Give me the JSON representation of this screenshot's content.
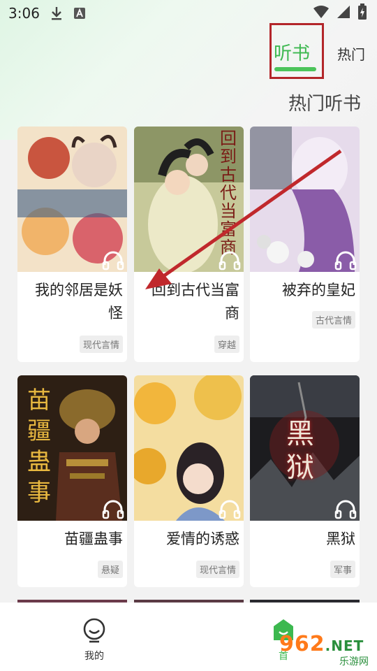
{
  "status_bar": {
    "time": "3:06",
    "icons": [
      "download-icon",
      "text-a-icon",
      "wifi-icon",
      "signal-icon",
      "battery-charging-icon"
    ]
  },
  "tabs": {
    "active": "听书",
    "other": "热门"
  },
  "section_title": "热门听书",
  "books": [
    {
      "title": "我的邻居是妖怪",
      "tag": "现代言情"
    },
    {
      "title": "回到古代当富商",
      "tag": "穿越"
    },
    {
      "title": "被弃的皇妃",
      "tag": "古代言情"
    },
    {
      "title": "苗疆蛊事",
      "tag": "悬疑"
    },
    {
      "title": "爱情的诱惑",
      "tag": "现代言情"
    },
    {
      "title": "黑狱",
      "tag": "军事"
    }
  ],
  "covers": {
    "c2_text": "回到古代当富商",
    "c4_text": "苗疆蛊事",
    "c6_text": "黑狱"
  },
  "bottom_nav": {
    "mine_label": "我的",
    "home_label": "首"
  },
  "watermark": {
    "brand": "962",
    "suffix": ".NET",
    "site": "乐游网"
  },
  "colors": {
    "accent": "#3cb84f",
    "highlight_box": "#b3262a",
    "annotation_arrow": "#c0282c"
  }
}
